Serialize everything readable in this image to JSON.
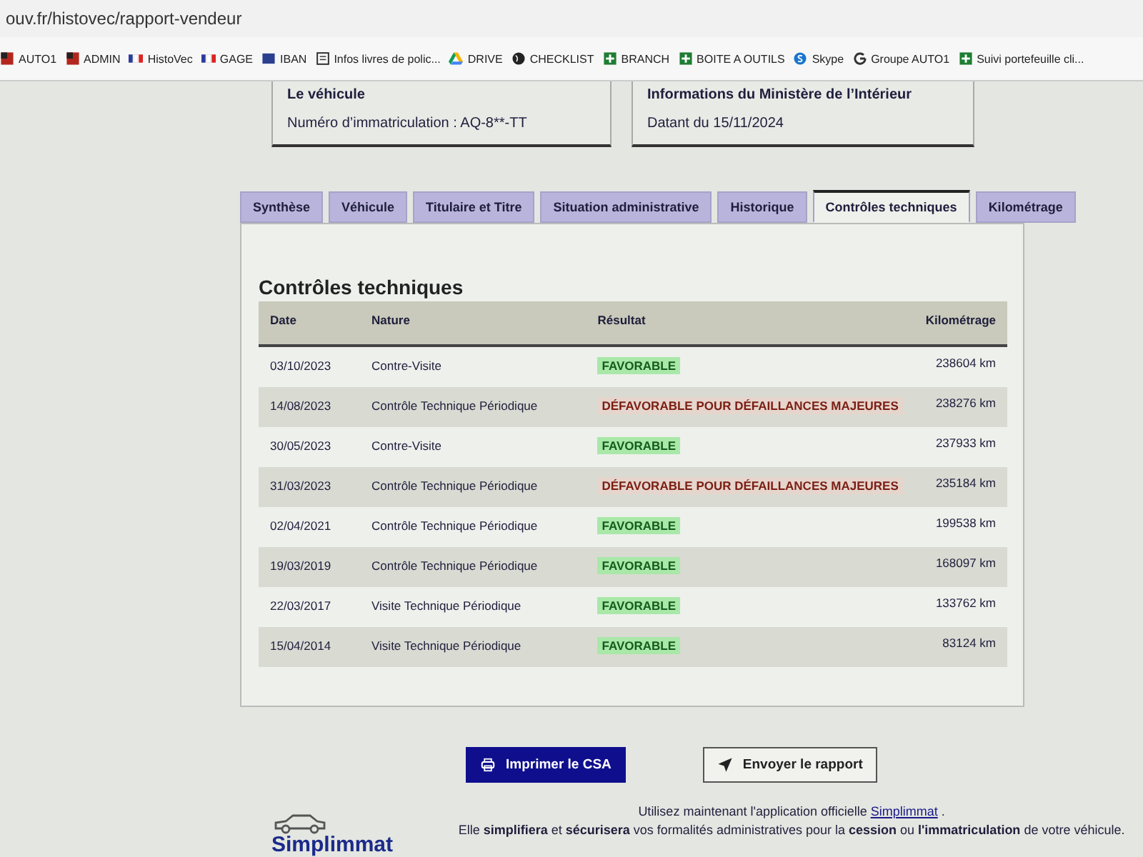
{
  "address_bar": {
    "url": "ouv.fr/histovec/rapport-vendeur"
  },
  "bookmarks": [
    {
      "label": "AUTO1"
    },
    {
      "label": "ADMIN"
    },
    {
      "label": "HistoVec"
    },
    {
      "label": "GAGE"
    },
    {
      "label": "IBAN"
    },
    {
      "label": "Infos livres de polic..."
    },
    {
      "label": "DRIVE"
    },
    {
      "label": "CHECKLIST"
    },
    {
      "label": "BRANCH"
    },
    {
      "label": "BOITE A OUTILS"
    },
    {
      "label": "Skype"
    },
    {
      "label": "Groupe AUTO1"
    },
    {
      "label": "Suivi portefeuille cli..."
    }
  ],
  "info_cards": [
    {
      "title": "Le véhicule",
      "text": "Numéro d’immatriculation : AQ-8**-TT"
    },
    {
      "title": "Informations du Ministère de l’Intérieur",
      "text": "Datant du 15/11/2024"
    }
  ],
  "tabs": [
    {
      "label": "Synthèse",
      "selected": false
    },
    {
      "label": "Véhicule",
      "selected": false
    },
    {
      "label": "Titulaire et Titre",
      "selected": false
    },
    {
      "label": "Situation administrative",
      "selected": false
    },
    {
      "label": "Historique",
      "selected": false
    },
    {
      "label": "Contrôles techniques",
      "selected": true
    },
    {
      "label": "Kilométrage",
      "selected": false
    }
  ],
  "section_title": "Contrôles techniques",
  "table": {
    "columns": [
      "Date",
      "Nature",
      "Résultat",
      "Kilométrage"
    ],
    "rows": [
      {
        "date": "03/10/2023",
        "nature": "Contre-Visite",
        "result": "FAVORABLE",
        "kind": "favorable",
        "km": "238604 km"
      },
      {
        "date": "14/08/2023",
        "nature": "Contrôle Technique Périodique",
        "result": "DÉFAVORABLE POUR DÉFAILLANCES MAJEURES",
        "kind": "defavorable",
        "km": "238276 km"
      },
      {
        "date": "30/05/2023",
        "nature": "Contre-Visite",
        "result": "FAVORABLE",
        "kind": "favorable",
        "km": "237933 km"
      },
      {
        "date": "31/03/2023",
        "nature": "Contrôle Technique Périodique",
        "result": "DÉFAVORABLE POUR DÉFAILLANCES MAJEURES",
        "kind": "defavorable",
        "km": "235184 km"
      },
      {
        "date": "02/04/2021",
        "nature": "Contrôle Technique Périodique",
        "result": "FAVORABLE",
        "kind": "favorable",
        "km": "199538 km"
      },
      {
        "date": "19/03/2019",
        "nature": "Contrôle Technique Périodique",
        "result": "FAVORABLE",
        "kind": "favorable",
        "km": "168097 km"
      },
      {
        "date": "22/03/2017",
        "nature": "Visite Technique Périodique",
        "result": "FAVORABLE",
        "kind": "favorable",
        "km": "133762 km"
      },
      {
        "date": "15/04/2014",
        "nature": "Visite Technique Périodique",
        "result": "FAVORABLE",
        "kind": "favorable",
        "km": "83124 km"
      }
    ]
  },
  "buttons": [
    {
      "label": "Imprimer le CSA",
      "kind": "primary"
    },
    {
      "label": "Envoyer le rapport",
      "kind": "secondary"
    }
  ],
  "footer": {
    "logo": "Simplimmat",
    "text_before": "Utilisez maintenant l'application officielle",
    "link": "Simplimmat",
    "text_after": ".",
    "text_2": "Elle **simplifiera** et **sécurisera** vos formalités administratives pour la **cession** ou **l'immatriculation** de votre véhicule."
  }
}
